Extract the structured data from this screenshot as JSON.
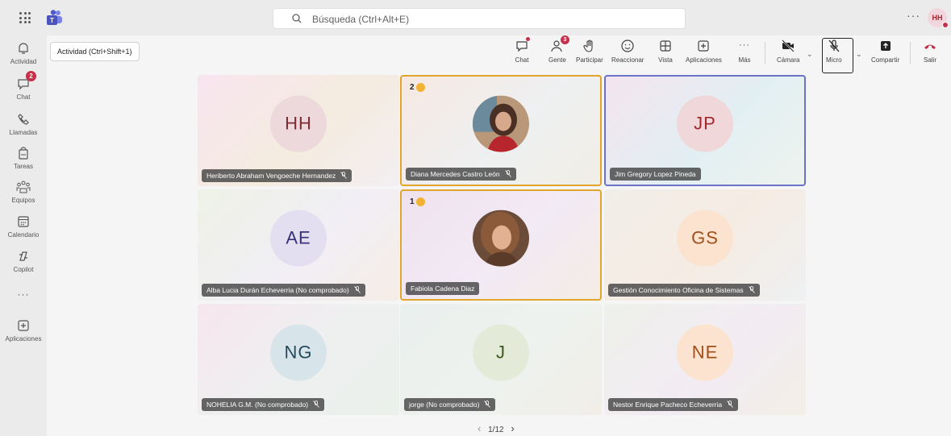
{
  "topbar": {
    "search_placeholder": "Búsqueda (Ctrl+Alt+E)",
    "more": "···",
    "avatar_initials": "HH"
  },
  "rail": {
    "items": [
      {
        "label": "Actividad",
        "icon": "bell-icon"
      },
      {
        "label": "Chat",
        "icon": "chat-icon",
        "badge": "2"
      },
      {
        "label": "Llamadas",
        "icon": "phone-icon"
      },
      {
        "label": "Tareas",
        "icon": "tasks-icon"
      },
      {
        "label": "Equipos",
        "icon": "teams-icon"
      },
      {
        "label": "Calendario",
        "icon": "calendar-icon"
      },
      {
        "label": "Copilot",
        "icon": "copilot-icon"
      },
      {
        "label": "···",
        "icon": "more-icon"
      },
      {
        "label": "Aplicaciones",
        "icon": "apps-icon"
      }
    ]
  },
  "tooltip": "Actividad (Ctrl+Shift+1)",
  "toolbar": {
    "chat": "Chat",
    "people": "Gente",
    "people_count": "3",
    "raise": "Participar",
    "react": "Reaccionar",
    "view": "Vista",
    "apps": "Aplicaciones",
    "more": "Más",
    "camera": "Cámara",
    "mic": "Micro",
    "share": "Compartir",
    "leave": "Salir"
  },
  "tiles": [
    {
      "name": "Heriberto Abraham Vengoeche Hernandez",
      "initials": "HH",
      "muted": true
    },
    {
      "name": "Diana Mercedes Castro León",
      "photo": true,
      "muted": true,
      "hand": "2"
    },
    {
      "name": "Jim Gregory Lopez Pineda",
      "initials": "JP",
      "muted": false
    },
    {
      "name": "Alba Lucia Durán Echeverria (No comprobado)",
      "initials": "AE",
      "muted": true
    },
    {
      "name": "Fabiola Cadena Diaz",
      "photo": true,
      "muted": false,
      "hand": "1"
    },
    {
      "name": "Gestión Conocimiento Oficina de Sistemas",
      "initials": "GS",
      "muted": true
    },
    {
      "name": "NOHELIA G.M. (No comprobado)",
      "initials": "NG",
      "muted": true
    },
    {
      "name": "jorge (No comprobado)",
      "initials": "J",
      "muted": true
    },
    {
      "name": "Nestor Enrique Pacheco Echeverria",
      "initials": "NE",
      "muted": true
    }
  ],
  "pager": "1/12",
  "colors": {
    "accent": "#5b5fc7",
    "raised_hand_border": "#e0a52a",
    "focus_border": "#6b72c8",
    "badge": "#c4314b",
    "leave": "#c4314b"
  }
}
